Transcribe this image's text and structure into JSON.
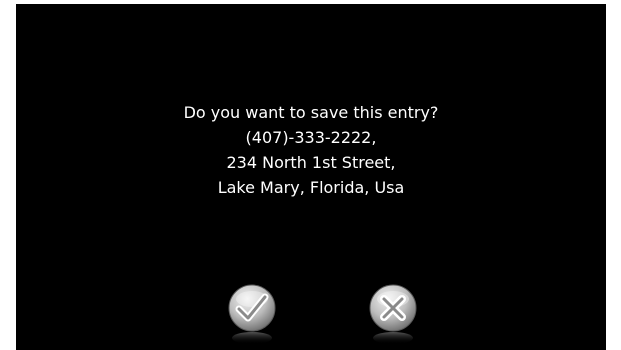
{
  "dialog": {
    "lines": [
      "Do you want to save this entry?",
      "(407)-333-2222,",
      "234 North 1st Street,",
      "Lake Mary, Florida, Usa"
    ]
  },
  "buttons": {
    "confirm_icon": "checkmark-icon",
    "cancel_icon": "close-icon"
  },
  "colors": {
    "background": "#000000",
    "text": "#ffffff",
    "button_face": "#b8b8b8"
  }
}
